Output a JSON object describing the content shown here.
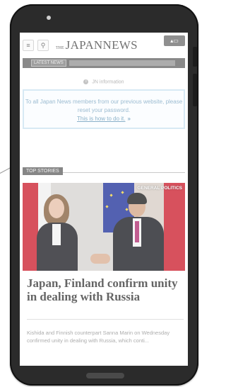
{
  "header": {
    "menu_icon": "menu-icon",
    "search_icon": "search-icon",
    "logo_the": "THE",
    "logo_name": "JAPANNEWS",
    "login_icon": "user-card-icon"
  },
  "latest_news": {
    "label": "LATEST NEWS"
  },
  "info": {
    "label": "JN information",
    "message": "To all Japan News members from our previous website, please reset your password.",
    "link_text": "This is how to do it.",
    "link_arrow": "»"
  },
  "top_stories": {
    "label": "TOP STORIES"
  },
  "article": {
    "image_caption": "GENERAL POLITICS",
    "headline": "Japan, Finland confirm unity in dealing with Russia",
    "summary": "Kishida and Finnish counterpart Sanna Marin on Wednesday confirmed unity in dealing with Russia, which conti..."
  },
  "colors": {
    "phone_body": "#2b2b2b",
    "info_border": "#cfe4f2",
    "info_text": "#87aec8",
    "header_gray": "#6f6f6f"
  }
}
